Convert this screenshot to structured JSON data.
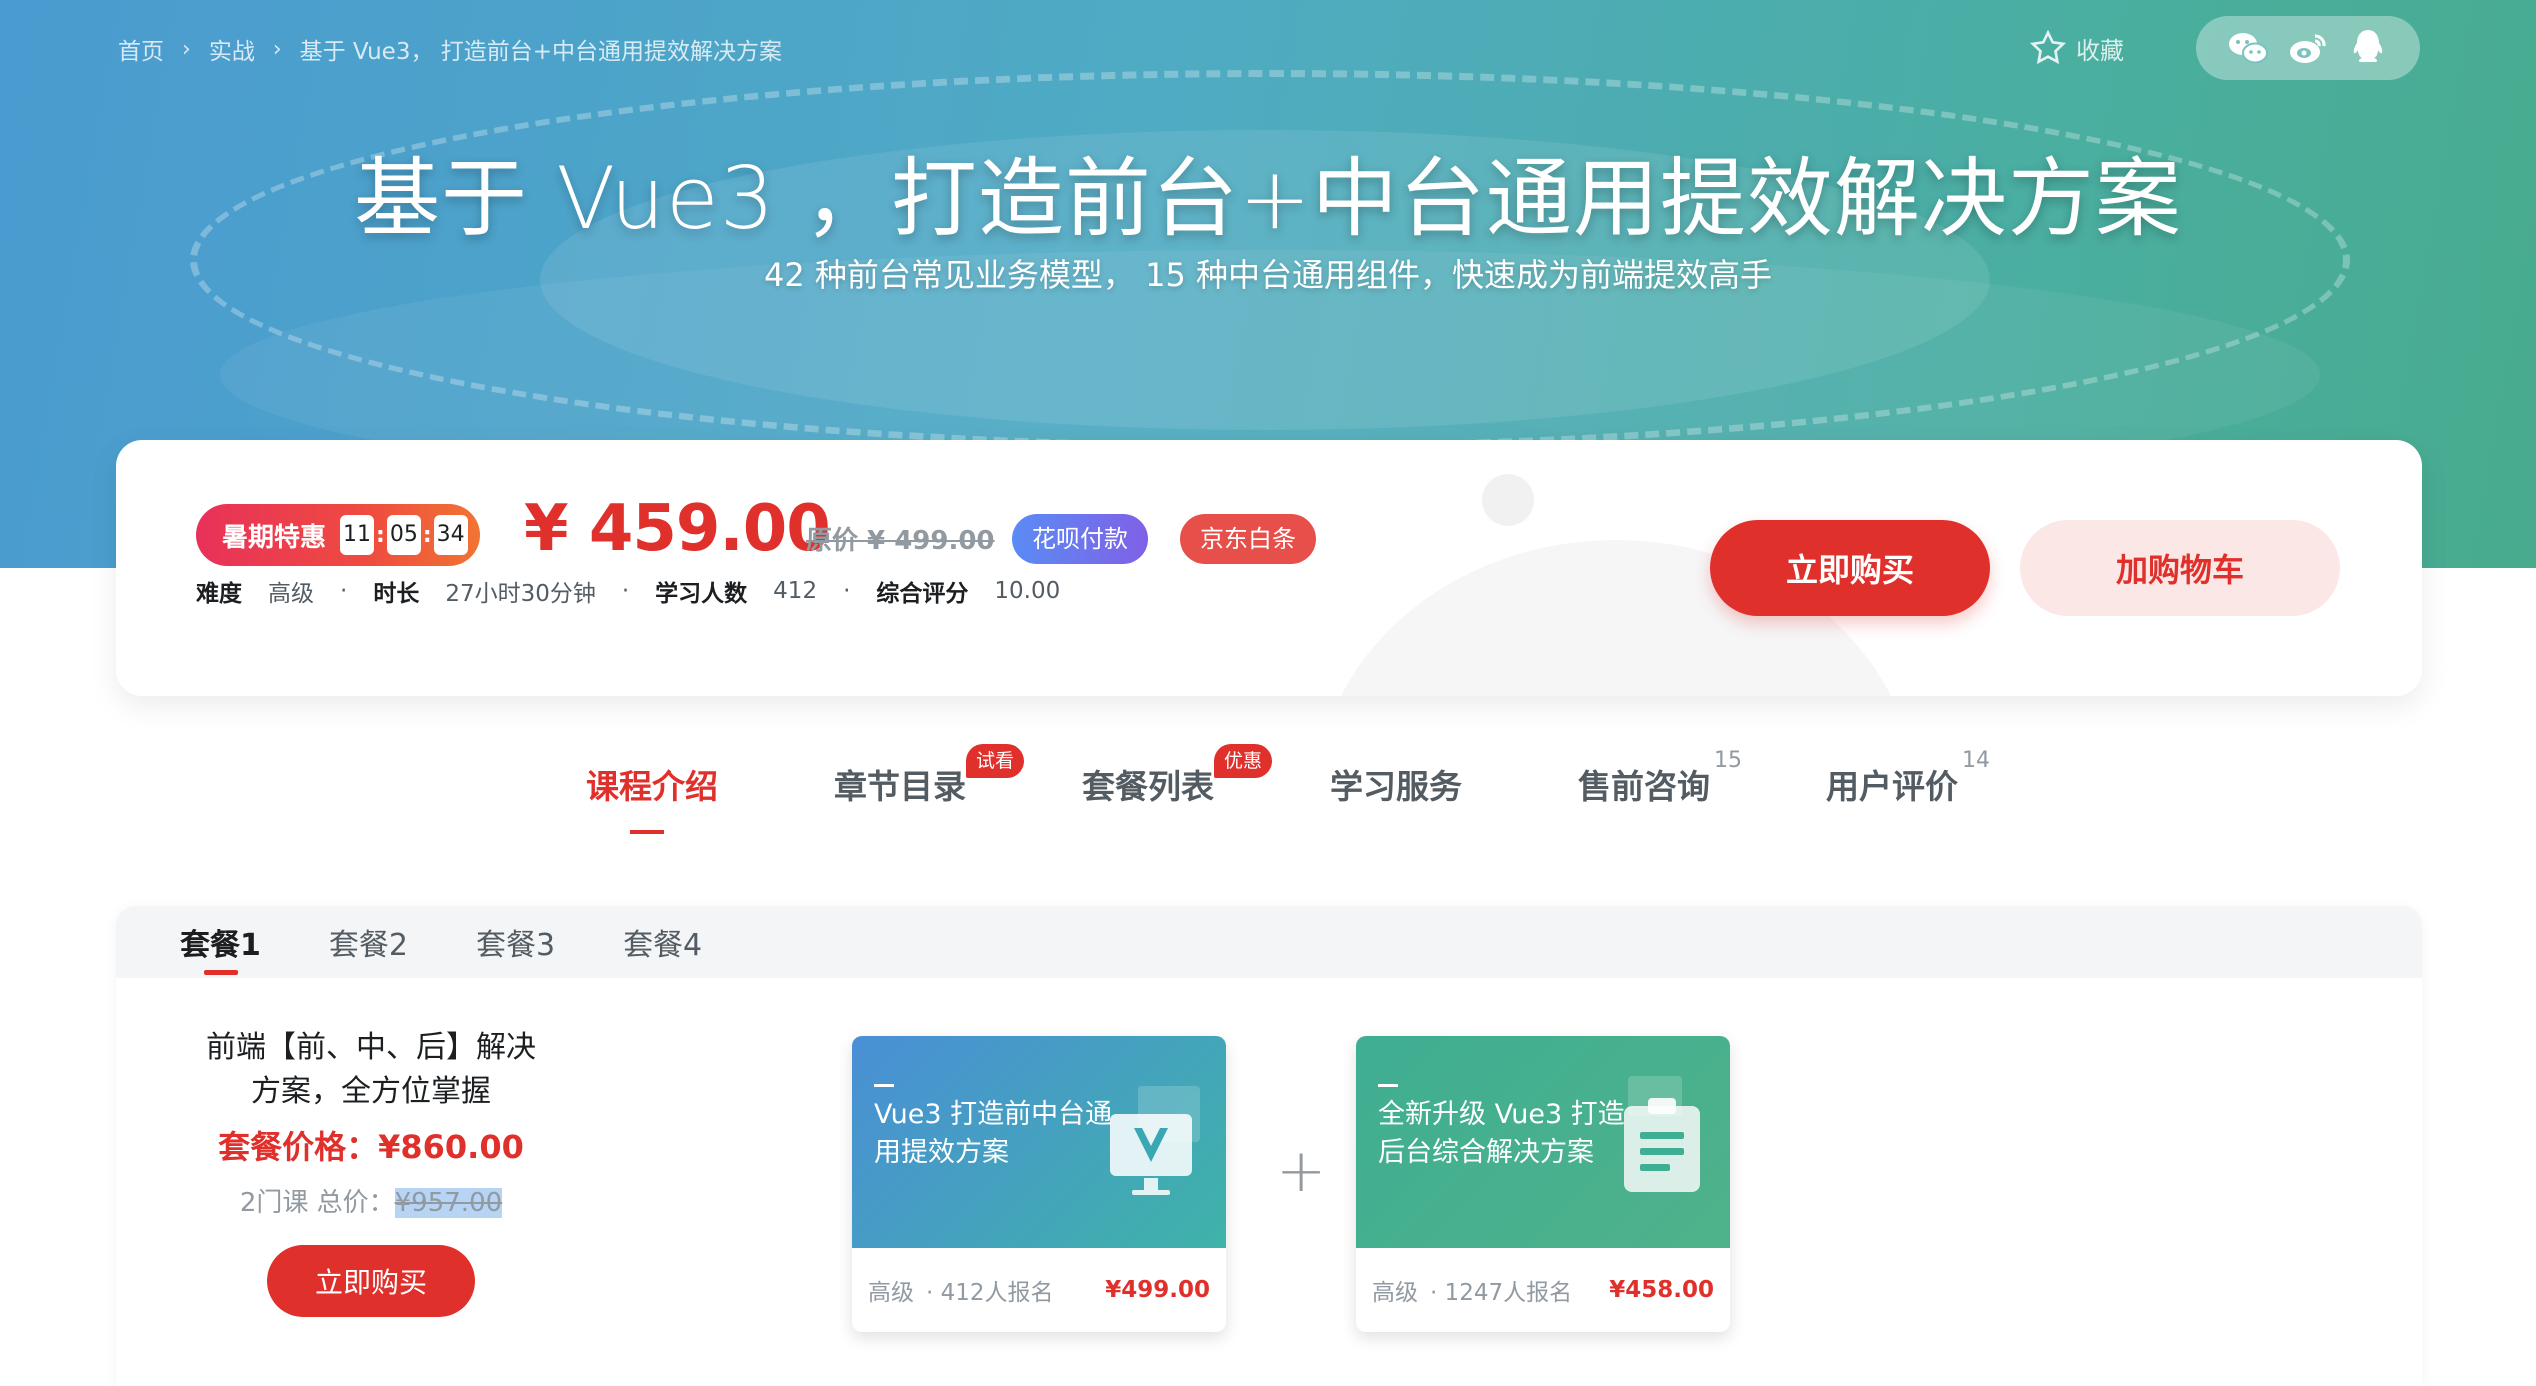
{
  "breadcrumb": {
    "home": "首页",
    "category": "实战",
    "current": "基于 Vue3， 打造前台+中台通用提效解决方案"
  },
  "header": {
    "favorite_label": "收藏"
  },
  "hero": {
    "title": "基于 Vue3 ，打造前台+中台通用提效解决方案",
    "subtitle": "42 种前台常见业务模型， 15 种中台通用组件，快速成为前端提效高手"
  },
  "pricing": {
    "promo_label": "暑期特惠",
    "countdown": {
      "h": "11",
      "m": "05",
      "s": "34"
    },
    "price": "¥ 459.00",
    "original_price": "原价 ¥ 499.00",
    "tag_huabei": "花呗付款",
    "tag_jd": "京东白条",
    "meta": {
      "difficulty_label": "难度",
      "difficulty": "高级",
      "duration_label": "时长",
      "duration": "27小时30分钟",
      "students_label": "学习人数",
      "students": "412",
      "rating_label": "综合评分",
      "rating": "10.00"
    },
    "buy_label": "立即购买",
    "cart_label": "加购物车"
  },
  "tabs": [
    {
      "label": "课程介绍"
    },
    {
      "label": "章节目录",
      "badge": "试看"
    },
    {
      "label": "套餐列表",
      "badge": "优惠"
    },
    {
      "label": "学习服务"
    },
    {
      "label": "售前咨询",
      "count": "15"
    },
    {
      "label": "用户评价",
      "count": "14"
    }
  ],
  "packages": {
    "tabs": [
      "套餐1",
      "套餐2",
      "套餐3",
      "套餐4"
    ],
    "name": "前端【前、中、后】解决方案，全方位掌握",
    "price": "套餐价格：¥860.00",
    "total_prefix": "2门课 总价：",
    "total_value": "¥957.00",
    "buy_label": "立即购买",
    "courses": [
      {
        "title": "Vue3 打造前中台通用提效方案",
        "level": "高级",
        "enrolled": "· 412人报名",
        "price": "¥499.00"
      },
      {
        "title": "全新升级 Vue3 打造后台综合解决方案",
        "level": "高级",
        "enrolled": "· 1247人报名",
        "price": "¥458.00"
      }
    ]
  },
  "colors": {
    "accent": "#e0302c",
    "banner_start": "#4a9bd0",
    "banner_end": "#48ab8e"
  }
}
